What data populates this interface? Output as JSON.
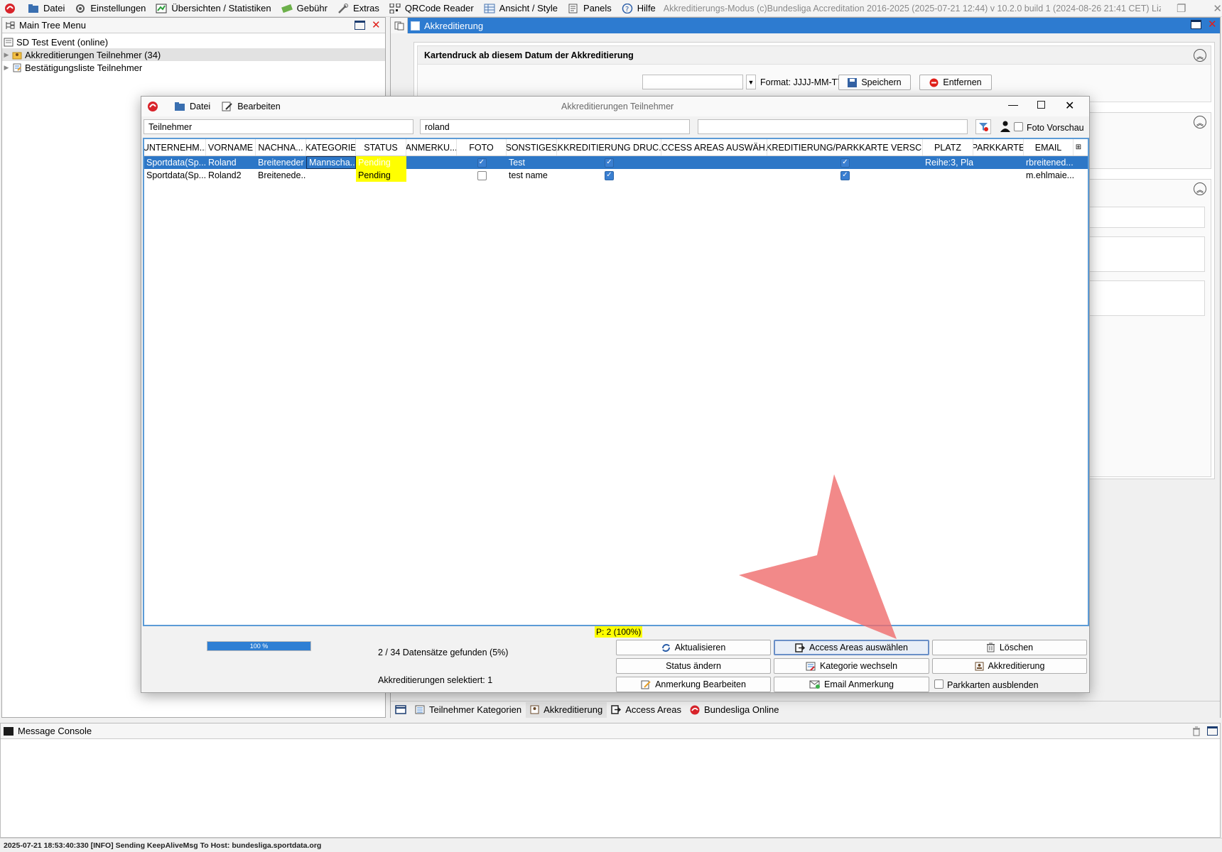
{
  "menubar": {
    "items": [
      {
        "label": "Datei",
        "icon": "folder-icon"
      },
      {
        "label": "Einstellungen",
        "icon": "gear-icon"
      },
      {
        "label": "Übersichten / Statistiken",
        "icon": "chart-icon"
      },
      {
        "label": "Gebühr",
        "icon": "money-icon"
      },
      {
        "label": "Extras",
        "icon": "tools-icon"
      },
      {
        "label": "QRCode Reader",
        "icon": "qr-icon"
      },
      {
        "label": "Ansicht / Style",
        "icon": "grid-icon"
      },
      {
        "label": "Panels",
        "icon": "panel-icon"
      },
      {
        "label": "Hilfe",
        "icon": "help-icon"
      }
    ],
    "title": "Akkreditierungs-Modus (c)Bundesliga Accreditation 2016-2025 (2025-07-21 12:44) v 10.2.0 build 1 (2024-08-26 21:41 CET) Lizenz: SDI..."
  },
  "tree": {
    "title": "Main Tree Menu",
    "root": "SD Test Event (online)",
    "items": [
      "Akkreditierungen Teilnehmer (34)",
      "Bestätigungsliste Teilnehmer"
    ]
  },
  "akk_panel": {
    "title": "Akkreditierung",
    "section_title": "Kartendruck ab diesem Datum der Akkreditierung",
    "date_value": "",
    "format_label": "Format: JJJJ-MM-TT",
    "save_label": "Speichern",
    "remove_label": "Entfernen"
  },
  "dialog": {
    "title": "Akkreditierungen Teilnehmer",
    "menu_file": "Datei",
    "menu_edit": "Bearbeiten",
    "filter_field": "Teilnehmer",
    "filter_value": "roland",
    "filter_extra": "",
    "photo_preview_label": "Foto Vorschau",
    "columns": [
      "UNTERNEHM...",
      "VORNAME",
      "NACHNA...",
      "KATEGORIE",
      "STATUS",
      "ANMERKU...",
      "FOTO",
      "SONSTIGES",
      "AKKREDITIERUNG DRUC...",
      "ACCESS AREAS AUSWÄH...",
      "AKKREDITIERUNG/PARKKARTE VERSCH...",
      "PLATZ",
      "PARKKARTE",
      "EMAIL"
    ],
    "rows": [
      {
        "company": "Sportdata(Sp...",
        "firstname": "Roland",
        "lastname": "Breiteneder",
        "category": "Mannscha...",
        "status": "Pending",
        "note": "",
        "photo": true,
        "misc": "Test",
        "print": true,
        "areas": "",
        "sent": true,
        "seat": "Reihe:3, Pla...",
        "parking": "",
        "email": "rbreitened..."
      },
      {
        "company": "Sportdata(Sp...",
        "firstname": "Roland2",
        "lastname": "Breitenede...",
        "category": "",
        "status": "Pending",
        "note": "",
        "photo": false,
        "misc": "test name",
        "print": true,
        "areas": "",
        "sent": true,
        "seat": "",
        "parking": "",
        "email": "m.ehlmaie..."
      }
    ],
    "pending_summary": "P: 2 (100%)",
    "progress_label": "100 %",
    "progress_value": 1.0,
    "records_found": "2 / 34 Datensätze gefunden (5%)",
    "selected_count": "Akkreditierungen selektiert: 1",
    "buttons": {
      "refresh": "Aktualisieren",
      "access_areas": "Access Areas auswählen",
      "delete": "Löschen",
      "status": "Status ändern",
      "category": "Kategorie wechseln",
      "accreditation": "Akkreditierung",
      "note": "Anmerkung Bearbeiten",
      "email": "Email Anmerkung",
      "hide_parking": "Parkkarten ausblenden"
    }
  },
  "bottom_tabs": [
    "Teilnehmer Kategorien",
    "Akkreditierung",
    "Access Areas",
    "Bundesliga Online"
  ],
  "console": {
    "title": "Message Console"
  },
  "statusbar": "2025-07-21 18:53:40:330 [INFO] Sending KeepAliveMsg To Host: bundesliga.sportdata.org",
  "colors": {
    "accent": "#2d77c7",
    "pending": "#ffff00",
    "progress": "#2f7fd4",
    "panel_header": "#2d7bd0"
  }
}
